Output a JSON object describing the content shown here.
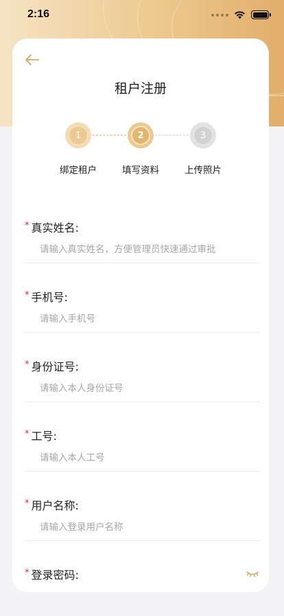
{
  "status_bar": {
    "time": "2:16"
  },
  "header": {
    "title": "租户注册"
  },
  "stepper": {
    "steps": [
      {
        "number": "1",
        "label": "绑定租户"
      },
      {
        "number": "2",
        "label": "填写资料"
      },
      {
        "number": "3",
        "label": "上传照片"
      }
    ]
  },
  "form": {
    "required_mark": "*",
    "fields": [
      {
        "label": "真实姓名:",
        "placeholder": "请输入真实姓名，方便管理员快速通过审批"
      },
      {
        "label": "手机号:",
        "placeholder": "请输入手机号"
      },
      {
        "label": "身份证号:",
        "placeholder": "请输入本人身份证号"
      },
      {
        "label": "工号:",
        "placeholder": "请输入本人工号"
      },
      {
        "label": "用户名称:",
        "placeholder": "请输入登录用户名称"
      },
      {
        "label": "登录密码:"
      }
    ]
  },
  "colors": {
    "accent": "#e3b56e",
    "required": "#e0283a"
  },
  "icons": [
    "back-arrow-icon",
    "wifi-icon",
    "battery-icon",
    "eye-closed-icon"
  ]
}
